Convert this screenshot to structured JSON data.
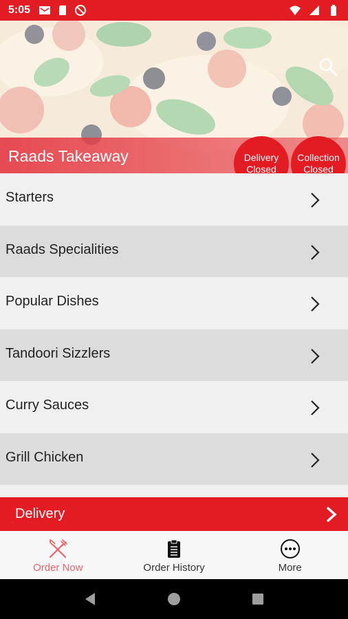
{
  "status_bar": {
    "time": "5:05",
    "left_icons": [
      "mail-icon",
      "sd-card-icon",
      "blocked-icon"
    ],
    "right_icons": [
      "wifi-icon",
      "signal-icon",
      "battery-icon"
    ]
  },
  "hero": {
    "title": "Raads Takeaway",
    "search_icon": "search-icon",
    "delivery_pill": {
      "line1": "Delivery",
      "line2": "Closed"
    },
    "collection_pill": {
      "line1": "Collection",
      "line2": "Closed"
    }
  },
  "menu": {
    "items": [
      {
        "label": "Starters"
      },
      {
        "label": "Raads Specialities"
      },
      {
        "label": "Popular Dishes"
      },
      {
        "label": "Tandoori Sizzlers"
      },
      {
        "label": "Curry Sauces"
      },
      {
        "label": "Grill Chicken"
      }
    ]
  },
  "delivery_bar": {
    "label": "Delivery"
  },
  "tabbar": {
    "tabs": [
      {
        "label": "Order Now",
        "icon": "fork-knife-icon",
        "active": true
      },
      {
        "label": "Order History",
        "icon": "clipboard-icon",
        "active": false
      },
      {
        "label": "More",
        "icon": "more-icon",
        "active": false
      }
    ]
  },
  "colors": {
    "brand_red": "#e31b23",
    "active_tab": "#e8676c"
  }
}
